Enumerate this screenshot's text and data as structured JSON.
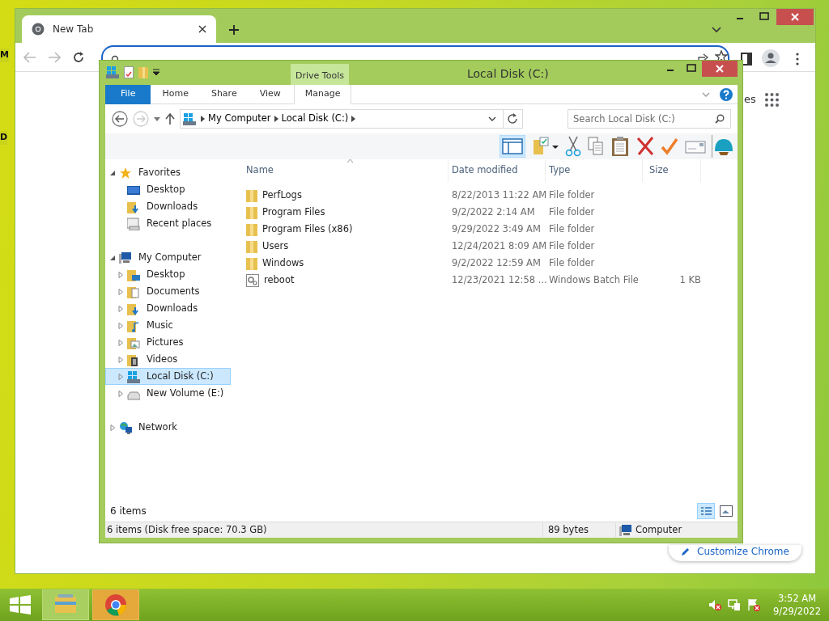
{
  "desktop": {
    "icon_labels": [
      "M",
      "D"
    ]
  },
  "browser": {
    "tabs": [
      {
        "label": "New Tab",
        "selected": true
      }
    ],
    "partial_link": "es",
    "customize_button": "Customize Chrome"
  },
  "explorer": {
    "title": "Local Disk (C:)",
    "context_group": "Drive Tools",
    "ribbon_tabs": [
      {
        "label": "File",
        "kind": "file"
      },
      {
        "label": "Home",
        "kind": "plain"
      },
      {
        "label": "Share",
        "kind": "plain"
      },
      {
        "label": "View",
        "kind": "plain"
      },
      {
        "label": "Manage",
        "kind": "contextual"
      }
    ],
    "breadcrumb": [
      "My Computer",
      "Local Disk (C:)"
    ],
    "search": {
      "placeholder": "Search Local Disk (C:)"
    },
    "nav_tree": [
      {
        "label": "Favorites",
        "kind": "star",
        "expanded": true,
        "selected": false,
        "children": [
          {
            "label": "Desktop",
            "kind": "desktop",
            "selected": false
          },
          {
            "label": "Downloads",
            "kind": "downloads",
            "selected": false
          },
          {
            "label": "Recent places",
            "kind": "recent",
            "selected": false
          }
        ]
      },
      {
        "label": "My Computer",
        "kind": "computer",
        "expanded": true,
        "selected": false,
        "children": [
          {
            "label": "Desktop",
            "kind": "desktop-folder",
            "expanded": false,
            "selected": false
          },
          {
            "label": "Documents",
            "kind": "documents",
            "expanded": false,
            "selected": false
          },
          {
            "label": "Downloads",
            "kind": "downloads",
            "expanded": false,
            "selected": false
          },
          {
            "label": "Music",
            "kind": "music",
            "expanded": false,
            "selected": false
          },
          {
            "label": "Pictures",
            "kind": "pictures",
            "expanded": false,
            "selected": false
          },
          {
            "label": "Videos",
            "kind": "videos",
            "expanded": false,
            "selected": false
          },
          {
            "label": "Local Disk (C:)",
            "kind": "drive",
            "expanded": false,
            "selected": true
          },
          {
            "label": "New Volume (E:)",
            "kind": "volume",
            "expanded": false,
            "selected": false
          }
        ]
      },
      {
        "label": "Network",
        "kind": "network",
        "expanded": false,
        "selected": false
      }
    ],
    "columns": [
      "Name",
      "Date modified",
      "Type",
      "Size"
    ],
    "rows": [
      {
        "name": "PerfLogs",
        "date": "8/22/2013 11:22 AM",
        "type": "File folder",
        "kind": "folder"
      },
      {
        "name": "Program Files",
        "date": "9/2/2022 2:14 AM",
        "type": "File folder",
        "kind": "folder"
      },
      {
        "name": "Program Files (x86)",
        "date": "9/29/2022 3:49 AM",
        "type": "File folder",
        "kind": "folder"
      },
      {
        "name": "Users",
        "date": "12/24/2021 8:09 AM",
        "type": "File folder",
        "kind": "folder"
      },
      {
        "name": "Windows",
        "date": "9/2/2022 12:59 AM",
        "type": "File folder",
        "kind": "folder"
      },
      {
        "name": "reboot",
        "date": "12/23/2021 12:58 ...",
        "type": "Windows Batch File",
        "size": "1 KB",
        "kind": "batch"
      }
    ],
    "item_count": "6 items",
    "status_bar": {
      "summary": "6 items (Disk free space: 70.3 GB)",
      "size": "89 bytes",
      "location": "Computer"
    }
  },
  "taskbar": {
    "clock_time": "3:52 AM",
    "clock_date": "9/29/2022"
  }
}
